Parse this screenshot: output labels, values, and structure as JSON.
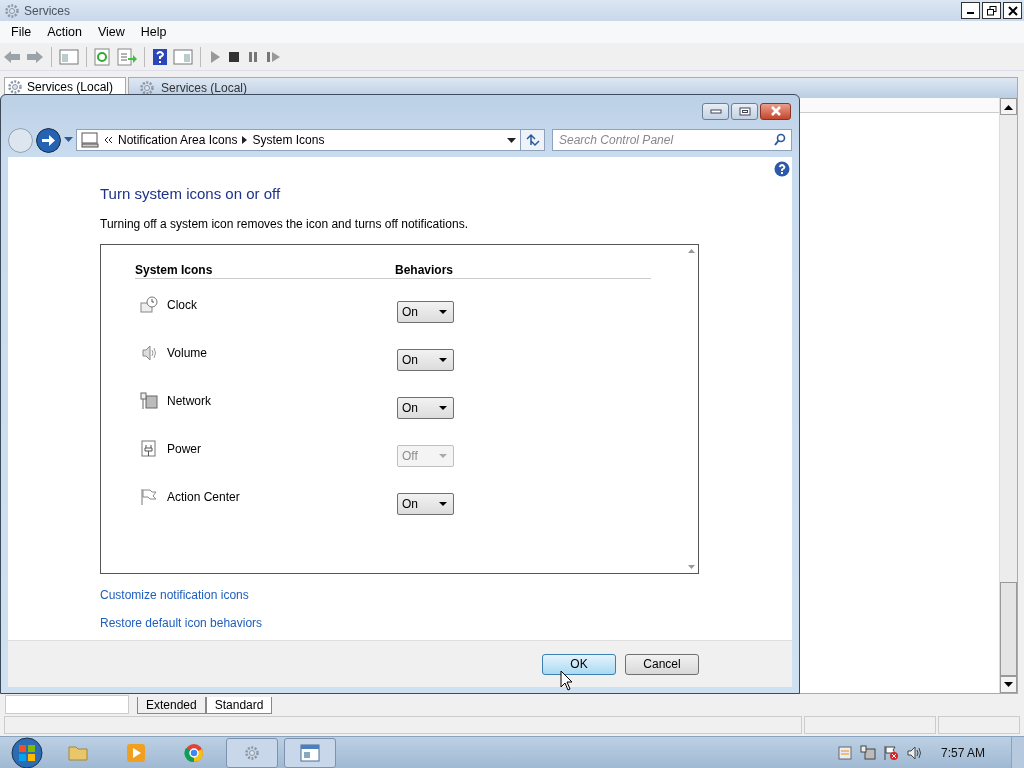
{
  "services_window": {
    "title": "Services",
    "menu": [
      "File",
      "Action",
      "View",
      "Help"
    ],
    "tree_item": "Services (Local)",
    "pane_header": "Services (Local)",
    "tabs": [
      {
        "label": "Extended",
        "selected": false
      },
      {
        "label": "Standard",
        "selected": true
      }
    ]
  },
  "dialog": {
    "breadcrumb": [
      "Notification Area Icons",
      "System Icons"
    ],
    "search": {
      "placeholder": "Search Control Panel"
    },
    "heading": "Turn system icons on or off",
    "description": "Turning off a system icon removes the icon and turns off notifications.",
    "columns": [
      "System Icons",
      "Behaviors"
    ],
    "icons": [
      {
        "kind": "clock",
        "name": "Clock",
        "behavior": "On",
        "disabled": false
      },
      {
        "kind": "volume",
        "name": "Volume",
        "behavior": "On",
        "disabled": false
      },
      {
        "kind": "network",
        "name": "Network",
        "behavior": "On",
        "disabled": false
      },
      {
        "kind": "power",
        "name": "Power",
        "behavior": "Off",
        "disabled": true
      },
      {
        "kind": "flag",
        "name": "Action Center",
        "behavior": "On",
        "disabled": false
      }
    ],
    "links": [
      "Customize notification icons",
      "Restore default icon behaviors"
    ],
    "buttons": [
      {
        "label": "OK",
        "default": true
      },
      {
        "label": "Cancel",
        "default": false
      }
    ]
  },
  "taskbar": {
    "clock": "7:57 AM"
  }
}
